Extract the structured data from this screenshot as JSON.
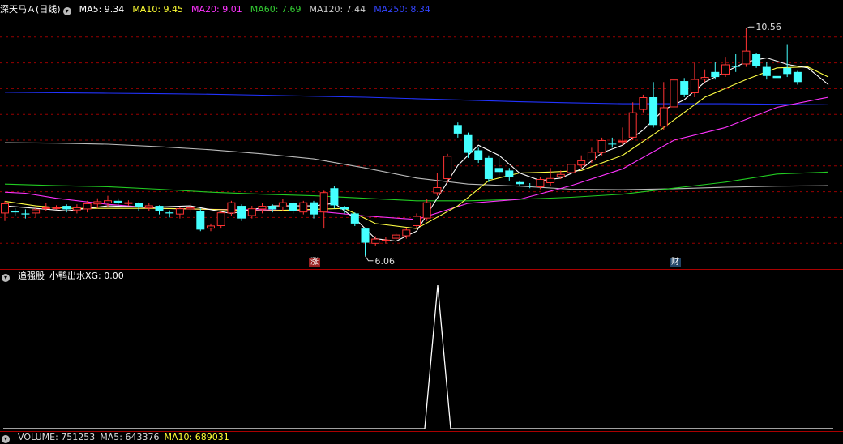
{
  "header": {
    "stock_name": "深天马Ａ(日线)",
    "ma_items": [
      {
        "text": "MA5: 9.34",
        "color": "#ffffff"
      },
      {
        "text": "MA10: 9.45",
        "color": "#ffff33"
      },
      {
        "text": "MA20: 9.01",
        "color": "#ff33ff"
      },
      {
        "text": "MA60: 7.69",
        "color": "#33cc33"
      },
      {
        "text": "MA120: 7.44",
        "color": "#cccccc"
      },
      {
        "text": "MA250: 8.34",
        "color": "#3333ff"
      }
    ]
  },
  "markers": {
    "zhang": "涨",
    "cai": "财"
  },
  "indicator_header": {
    "name": "追强股",
    "sub": "小鸭出水XG: 0.00"
  },
  "volume_header": [
    {
      "text": "VOLUME: 751253",
      "color": "#dddddd"
    },
    {
      "text": "MA5: 643376",
      "color": "#dddddd"
    },
    {
      "text": "MA10: 689031",
      "color": "#ffff33"
    }
  ],
  "colors": {
    "up": "#ff3333",
    "down": "#44ffff",
    "grid": "#990000",
    "ma250": "#2233ff",
    "ma120": "#bbbbbb",
    "ma60": "#22cc22",
    "ma20": "#ff33ff",
    "ma10": "#ffff44",
    "ma5": "#ffffff"
  },
  "chart_data": {
    "type": "candlestick",
    "annotations": {
      "high": "10.56",
      "low": "6.06"
    },
    "ylim": [
      5.8,
      10.9
    ],
    "candles": [
      [
        6.9,
        7.1,
        6.75,
        7.15
      ],
      [
        6.95,
        6.92,
        6.85,
        7.0
      ],
      [
        6.9,
        6.88,
        6.8,
        6.98
      ],
      [
        6.9,
        6.98,
        6.82,
        7.02
      ],
      [
        7.0,
        7.02,
        6.95,
        7.1
      ],
      [
        7.01,
        7.02,
        6.98,
        7.06
      ],
      [
        7.05,
        6.98,
        6.92,
        7.08
      ],
      [
        6.96,
        7.02,
        6.9,
        7.08
      ],
      [
        6.98,
        7.1,
        6.92,
        7.15
      ],
      [
        7.08,
        7.14,
        7.0,
        7.2
      ],
      [
        7.1,
        7.16,
        7.02,
        7.25
      ],
      [
        7.15,
        7.1,
        7.05,
        7.2
      ],
      [
        7.1,
        7.12,
        7.05,
        7.16
      ],
      [
        7.1,
        7.02,
        6.95,
        7.12
      ],
      [
        7.0,
        7.06,
        6.95,
        7.1
      ],
      [
        7.05,
        6.95,
        6.88,
        7.06
      ],
      [
        6.92,
        6.9,
        6.82,
        6.96
      ],
      [
        6.88,
        7.0,
        6.8,
        7.02
      ],
      [
        6.98,
        7.02,
        6.92,
        7.1
      ],
      [
        6.95,
        6.58,
        6.55,
        7.0
      ],
      [
        6.6,
        6.66,
        6.55,
        6.7
      ],
      [
        6.65,
        6.92,
        6.6,
        6.95
      ],
      [
        6.9,
        7.12,
        6.85,
        7.15
      ],
      [
        7.05,
        6.8,
        6.75,
        7.08
      ],
      [
        6.85,
        7.0,
        6.8,
        7.05
      ],
      [
        6.98,
        7.05,
        6.9,
        7.1
      ],
      [
        7.05,
        6.98,
        6.92,
        7.08
      ],
      [
        7.02,
        7.12,
        6.95,
        7.18
      ],
      [
        7.1,
        6.95,
        6.9,
        7.12
      ],
      [
        6.92,
        7.12,
        6.88,
        7.15
      ],
      [
        7.12,
        6.88,
        6.8,
        7.15
      ],
      [
        6.92,
        7.32,
        6.6,
        7.35
      ],
      [
        7.4,
        7.06,
        7.0,
        7.45
      ],
      [
        7.02,
        6.98,
        6.9,
        7.05
      ],
      [
        6.9,
        6.7,
        6.65,
        6.92
      ],
      [
        6.6,
        6.32,
        6.06,
        6.62
      ],
      [
        6.3,
        6.4,
        6.25,
        6.45
      ],
      [
        6.38,
        6.38,
        6.3,
        6.44
      ],
      [
        6.4,
        6.48,
        6.35,
        6.52
      ],
      [
        6.45,
        6.58,
        6.4,
        6.62
      ],
      [
        6.65,
        6.85,
        6.6,
        6.9
      ],
      [
        6.8,
        7.12,
        6.75,
        7.18
      ],
      [
        7.3,
        7.42,
        7.25,
        7.7
      ],
      [
        7.58,
        8.04,
        7.5,
        8.08
      ],
      [
        8.65,
        8.48,
        8.4,
        8.7
      ],
      [
        8.45,
        8.1,
        8.0,
        8.5
      ],
      [
        8.15,
        7.95,
        7.9,
        8.2
      ],
      [
        8.0,
        7.58,
        7.52,
        8.05
      ],
      [
        7.8,
        7.72,
        7.65,
        8.0
      ],
      [
        7.75,
        7.62,
        7.55,
        7.8
      ],
      [
        7.52,
        7.48,
        7.45,
        7.55
      ],
      [
        7.45,
        7.44,
        7.4,
        7.5
      ],
      [
        7.42,
        7.58,
        7.38,
        7.62
      ],
      [
        7.5,
        7.6,
        7.45,
        7.8
      ],
      [
        7.62,
        7.68,
        7.58,
        7.75
      ],
      [
        7.7,
        7.88,
        7.65,
        7.95
      ],
      [
        7.85,
        7.95,
        7.8,
        8.05
      ],
      [
        7.95,
        8.12,
        7.9,
        8.2
      ],
      [
        8.1,
        8.35,
        8.05,
        8.4
      ],
      [
        8.28,
        8.27,
        8.2,
        8.4
      ],
      [
        8.32,
        8.34,
        8.25,
        8.6
      ],
      [
        8.4,
        8.9,
        8.35,
        9.1
      ],
      [
        8.95,
        9.2,
        8.9,
        9.25
      ],
      [
        9.2,
        8.65,
        8.6,
        9.5
      ],
      [
        8.62,
        9.0,
        8.55,
        9.5
      ],
      [
        9.0,
        9.55,
        8.95,
        9.62
      ],
      [
        9.52,
        9.25,
        9.2,
        9.58
      ],
      [
        9.28,
        9.56,
        9.2,
        9.88
      ],
      [
        9.55,
        9.6,
        9.5,
        9.75
      ],
      [
        9.7,
        9.6,
        9.55,
        9.9
      ],
      [
        9.65,
        9.85,
        9.6,
        10.0
      ],
      [
        9.82,
        9.8,
        9.7,
        10.05
      ],
      [
        9.85,
        10.12,
        9.8,
        10.56
      ],
      [
        10.05,
        9.82,
        9.78,
        10.08
      ],
      [
        9.8,
        9.62,
        9.55,
        9.9
      ],
      [
        9.62,
        9.58,
        9.52,
        9.7
      ],
      [
        9.78,
        9.66,
        9.6,
        10.25
      ],
      [
        9.7,
        9.5,
        9.45,
        9.72
      ]
    ],
    "ma250": [
      [
        0,
        9.3
      ],
      [
        5,
        9.29
      ],
      [
        10,
        9.28
      ],
      [
        15,
        9.27
      ],
      [
        20,
        9.26
      ],
      [
        25,
        9.24
      ],
      [
        30,
        9.22
      ],
      [
        35,
        9.2
      ],
      [
        40,
        9.17
      ],
      [
        45,
        9.14
      ],
      [
        50,
        9.11
      ],
      [
        55,
        9.09
      ],
      [
        60,
        9.07
      ],
      [
        65,
        9.07
      ],
      [
        70,
        9.07
      ],
      [
        75,
        9.06
      ],
      [
        80,
        9.05
      ]
    ],
    "ma120": [
      [
        0,
        8.3
      ],
      [
        5,
        8.29
      ],
      [
        10,
        8.27
      ],
      [
        15,
        8.22
      ],
      [
        20,
        8.16
      ],
      [
        25,
        8.08
      ],
      [
        30,
        7.98
      ],
      [
        35,
        7.8
      ],
      [
        40,
        7.6
      ],
      [
        45,
        7.48
      ],
      [
        50,
        7.44
      ],
      [
        55,
        7.38
      ],
      [
        60,
        7.37
      ],
      [
        65,
        7.39
      ],
      [
        70,
        7.42
      ],
      [
        75,
        7.44
      ],
      [
        80,
        7.45
      ]
    ],
    "ma60": [
      [
        0,
        7.48
      ],
      [
        5,
        7.45
      ],
      [
        10,
        7.43
      ],
      [
        15,
        7.38
      ],
      [
        20,
        7.32
      ],
      [
        25,
        7.28
      ],
      [
        30,
        7.25
      ],
      [
        35,
        7.2
      ],
      [
        40,
        7.15
      ],
      [
        45,
        7.15
      ],
      [
        50,
        7.18
      ],
      [
        55,
        7.22
      ],
      [
        60,
        7.28
      ],
      [
        65,
        7.4
      ],
      [
        70,
        7.52
      ],
      [
        75,
        7.68
      ],
      [
        80,
        7.72
      ]
    ],
    "ma20": [
      [
        0,
        7.32
      ],
      [
        2,
        7.3
      ],
      [
        5,
        7.2
      ],
      [
        10,
        7.08
      ],
      [
        15,
        7.0
      ],
      [
        20,
        6.98
      ],
      [
        25,
        6.97
      ],
      [
        30,
        6.95
      ],
      [
        35,
        6.85
      ],
      [
        40,
        6.78
      ],
      [
        45,
        7.1
      ],
      [
        50,
        7.18
      ],
      [
        55,
        7.45
      ],
      [
        60,
        7.78
      ],
      [
        65,
        8.35
      ],
      [
        70,
        8.6
      ],
      [
        75,
        9.0
      ],
      [
        80,
        9.2
      ]
    ],
    "ma10": [
      [
        0,
        7.14
      ],
      [
        3,
        7.05
      ],
      [
        6,
        7.0
      ],
      [
        10,
        7.0
      ],
      [
        15,
        7.0
      ],
      [
        20,
        6.98
      ],
      [
        25,
        6.95
      ],
      [
        30,
        6.98
      ],
      [
        33,
        7.0
      ],
      [
        36,
        6.7
      ],
      [
        40,
        6.6
      ],
      [
        44,
        7.05
      ],
      [
        47,
        7.55
      ],
      [
        50,
        7.7
      ],
      [
        53,
        7.72
      ],
      [
        56,
        7.75
      ],
      [
        60,
        8.05
      ],
      [
        64,
        8.6
      ],
      [
        68,
        9.2
      ],
      [
        72,
        9.55
      ],
      [
        75,
        9.78
      ],
      [
        78,
        9.8
      ],
      [
        80,
        9.6
      ]
    ],
    "ma5": [
      [
        0,
        7.05
      ],
      [
        3,
        7.0
      ],
      [
        6,
        6.95
      ],
      [
        10,
        7.05
      ],
      [
        14,
        7.02
      ],
      [
        18,
        7.05
      ],
      [
        22,
        6.9
      ],
      [
        26,
        7.05
      ],
      [
        30,
        7.05
      ],
      [
        32,
        7.1
      ],
      [
        34,
        6.8
      ],
      [
        36,
        6.4
      ],
      [
        38,
        6.35
      ],
      [
        40,
        6.55
      ],
      [
        42,
        7.2
      ],
      [
        44,
        7.85
      ],
      [
        46,
        8.25
      ],
      [
        48,
        8.05
      ],
      [
        50,
        7.7
      ],
      [
        52,
        7.55
      ],
      [
        54,
        7.6
      ],
      [
        56,
        7.78
      ],
      [
        58,
        8.1
      ],
      [
        60,
        8.25
      ],
      [
        62,
        8.55
      ],
      [
        64,
        8.95
      ],
      [
        66,
        9.15
      ],
      [
        68,
        9.5
      ],
      [
        70,
        9.7
      ],
      [
        72,
        9.9
      ],
      [
        74,
        9.98
      ],
      [
        76,
        9.85
      ],
      [
        78,
        9.78
      ],
      [
        80,
        9.45
      ]
    ]
  }
}
